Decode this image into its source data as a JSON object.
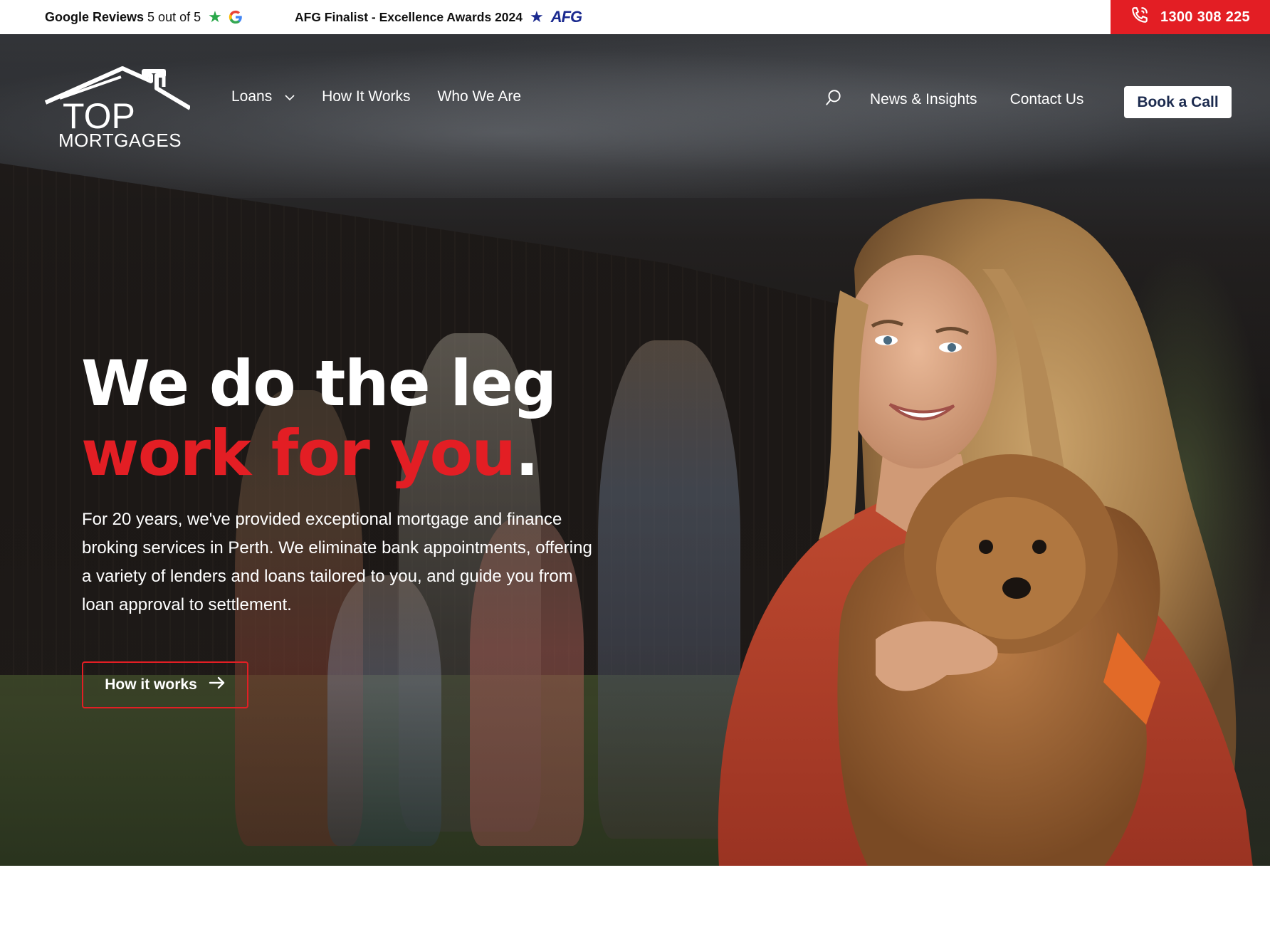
{
  "topbar": {
    "reviews_label": "Google Reviews",
    "reviews_score": "5 out of 5",
    "award_text": "AFG Finalist - Excellence Awards 2024",
    "afg_logo_text": "AFG",
    "phone_number": "1300 308 225",
    "phone_bg_color": "#e31e24"
  },
  "nav": {
    "logo_top": "TOP",
    "logo_bottom": "MORTGAGES",
    "links_left": [
      {
        "label": "Loans",
        "has_dropdown": true
      },
      {
        "label": "How It Works"
      },
      {
        "label": "Who We Are"
      }
    ],
    "links_right": [
      {
        "label": "News & Insights"
      },
      {
        "label": "Contact Us"
      }
    ],
    "search_icon": "search-icon",
    "book_call_label": "Book a Call"
  },
  "hero": {
    "headline_line1": "We do the leg",
    "headline_line2_red": "work for you",
    "headline_line2_dot": ".",
    "lede": "For 20 years, we've provided exceptional mortgage and finance broking services in Perth. We eliminate bank appointments, offering a variety of lenders and loans tailored to you, and guide you from loan approval to settlement.",
    "cta_label": "How it works",
    "accent_color": "#e31e24"
  }
}
